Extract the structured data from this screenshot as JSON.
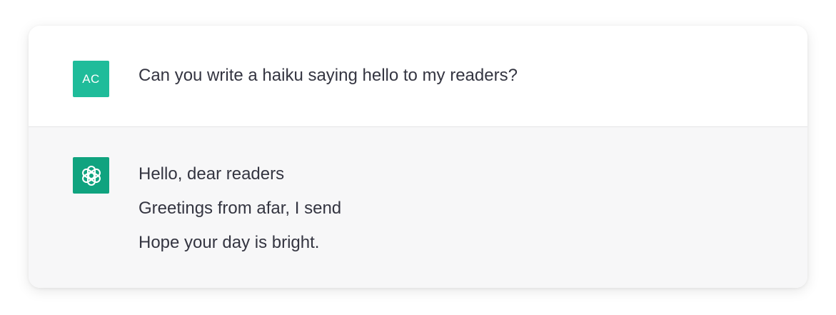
{
  "conversation": {
    "user": {
      "avatar_initials": "AC",
      "avatar_color": "#1fbc9a",
      "message": "Can you write a haiku saying hello to my readers?"
    },
    "assistant": {
      "avatar_icon": "openai-logo-icon",
      "avatar_color": "#10a37f",
      "lines": [
        "Hello, dear readers",
        "Greetings from afar, I send",
        "Hope your day is bright."
      ]
    }
  },
  "colors": {
    "text": "#343541",
    "assistant_bg": "#f7f7f8",
    "divider": "#e3e3e6"
  }
}
